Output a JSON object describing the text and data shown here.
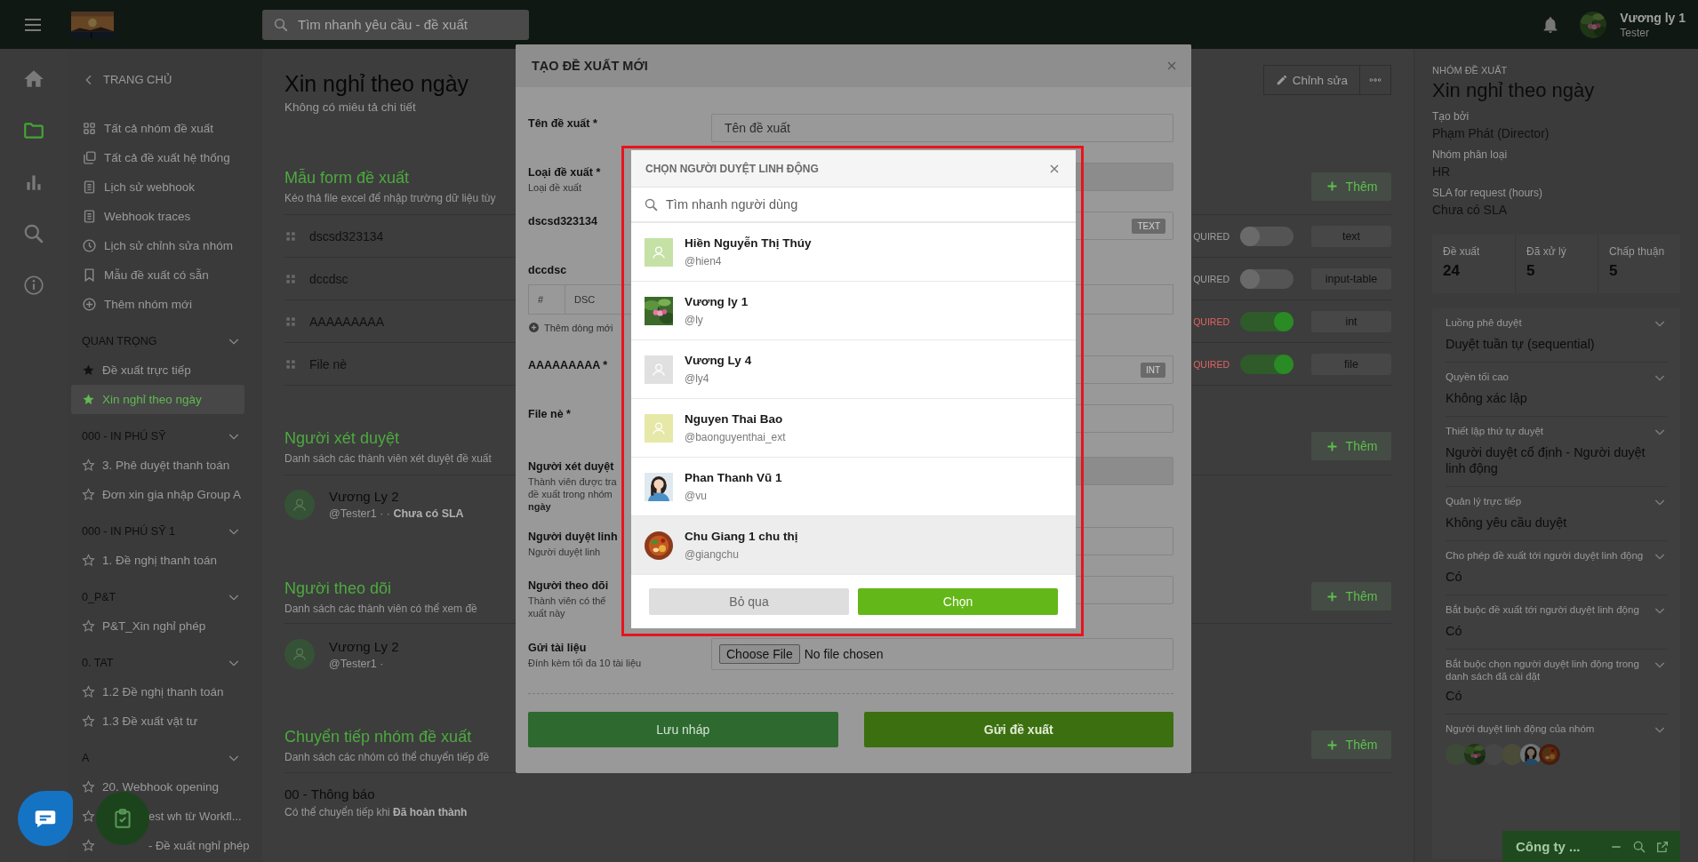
{
  "top_bar": {
    "search": {
      "placeholder": "Tìm nhanh yêu cầu - đề xuất"
    },
    "user": {
      "name": "Vương ly 1",
      "role": "Tester"
    }
  },
  "rail": [
    {
      "kind": "home",
      "selected": false
    },
    {
      "kind": "folder",
      "selected": true
    },
    {
      "kind": "chart",
      "selected": false
    },
    {
      "kind": "search",
      "selected": false
    },
    {
      "kind": "info",
      "selected": false
    }
  ],
  "sidebar": {
    "back_label": "TRANG CHỦ",
    "links": [
      {
        "kind": "grid",
        "label": "Tất cả nhóm đề xuất"
      },
      {
        "kind": "copy",
        "label": "Tất cả đề xuất hệ thống"
      },
      {
        "kind": "document",
        "label": "Lịch sử webhook"
      },
      {
        "kind": "document",
        "label": "Webhook traces"
      },
      {
        "kind": "clock",
        "label": "Lịch sử chỉnh sửa nhóm"
      },
      {
        "kind": "bookmark",
        "label": "Mẫu đề xuất có sẵn"
      },
      {
        "kind": "plus-circle",
        "label": "Thêm nhóm mới"
      }
    ],
    "groups": [
      {
        "title": "QUAN TRỌNG",
        "expanded": true,
        "items": [
          {
            "kind": "item",
            "label": "Đề xuất trực tiếp",
            "starred": true,
            "selected": false
          },
          {
            "kind": "item",
            "label": "Xin nghỉ theo ngày",
            "starred": true,
            "selected": true
          }
        ]
      },
      {
        "title": "000 - IN PHÚ SỸ",
        "expanded": true,
        "items": [
          {
            "kind": "item",
            "label": "3. Phê duyệt thanh toán",
            "starred": false,
            "selected": false
          },
          {
            "kind": "item",
            "label": "Đơn xin gia nhập Group A",
            "starred": false,
            "selected": false
          }
        ]
      },
      {
        "title": "000 - IN PHÚ SỸ 1",
        "expanded": true,
        "items": [
          {
            "kind": "item",
            "label": "1. Đề nghị thanh toán",
            "starred": false,
            "selected": false
          }
        ]
      },
      {
        "title": "0_P&T",
        "expanded": true,
        "items": [
          {
            "kind": "item",
            "label": "P&T_Xin nghỉ phép",
            "starred": false,
            "selected": false
          }
        ]
      },
      {
        "title": "0. TAT",
        "expanded": true,
        "items": [
          {
            "kind": "item",
            "label": "1.2 Đề nghị thanh toán",
            "starred": false,
            "selected": false
          },
          {
            "kind": "item",
            "label": "1.3 Đề xuất vật tư",
            "starred": false,
            "selected": false
          }
        ]
      },
      {
        "title": "A",
        "expanded": true,
        "items": [
          {
            "kind": "item",
            "label": "20. Webhook opening",
            "starred": false,
            "selected": false
          },
          {
            "kind": "covered",
            "label": "est wh từ Workfl...",
            "starred": false,
            "selected": false
          },
          {
            "kind": "covered",
            "label": "- Đề xuất nghỉ phép",
            "starred": false,
            "selected": false
          }
        ]
      }
    ]
  },
  "main": {
    "title": "Xin nghỉ theo ngày",
    "subtitle": "Không có miêu tả chi tiết",
    "edit_button": "Chỉnh sửa",
    "form_section": {
      "title": "Mẫu form đề xuất",
      "description": "Kéo thả file excel để nhập trường dữ liệu tùy",
      "add_button": "Thêm",
      "fields": [
        {
          "name": "dscsd323134",
          "required_label": "QUIRED",
          "required": false,
          "type": "text"
        },
        {
          "name": "dccdsc",
          "required_label": "QUIRED",
          "required": false,
          "type": "input-table"
        },
        {
          "name": "AAAAAAAAA",
          "required_label": "QUIRED",
          "required": true,
          "type": "int"
        },
        {
          "name": "File nè",
          "required_label": "QUIRED",
          "required": true,
          "type": "file"
        }
      ]
    },
    "reviewers": {
      "title": "Người xét duyệt",
      "description": "Danh sách các thành viên xét duyệt đề xuất",
      "add_button": "Thêm",
      "members": [
        {
          "name": "Vương Ly 2",
          "meta": "@Tester1 · · **Chưa có SLA**"
        }
      ]
    },
    "followers": {
      "title": "Người theo dõi",
      "description": "Danh sách các thành viên có thể xem đề",
      "add_button": "Thêm",
      "members": [
        {
          "name": "Vương Ly 2",
          "meta": "@Tester1 ·"
        }
      ]
    },
    "forwarding": {
      "title": "Chuyển tiếp nhóm đề xuất",
      "description": "Danh sách các nhóm có thể chuyển tiếp đề",
      "add_button": "Thêm",
      "groups": [
        {
          "name": "00 - Thông báo",
          "condition": "Có thể chuyển tiếp khi **Đã hoàn thành**"
        }
      ]
    }
  },
  "details": {
    "label": "NHÓM ĐỀ XUẤT",
    "title": "Xin nghỉ theo ngày",
    "facts": [
      {
        "label": "Tạo bởi",
        "value": "Phạm Phát (Director)"
      },
      {
        "label": "Nhóm phân loại",
        "value": "HR"
      },
      {
        "label": "SLA for request (hours)",
        "value": "Chưa có SLA"
      }
    ],
    "stats": [
      {
        "label": "Đề xuất",
        "value": "24"
      },
      {
        "label": "Đã xử lý",
        "value": "5"
      },
      {
        "label": "Chấp thuận",
        "value": "5"
      }
    ],
    "settings": [
      {
        "kind": "text",
        "label": "Luồng phê duyệt",
        "value": "Duyệt tuần tự (sequential)"
      },
      {
        "kind": "text",
        "label": "Quyền tối cao",
        "value": "Không xác lập"
      },
      {
        "kind": "text",
        "label": "Thiết lập thứ tự duyệt",
        "value": "Người duyệt cố định - Người duyệt linh động"
      },
      {
        "kind": "text",
        "label": "Quản lý trực tiếp",
        "value": "Không yêu cầu duyệt"
      },
      {
        "kind": "text",
        "label": "Cho phép đề xuất tới người duyệt linh động",
        "value": "Có"
      },
      {
        "kind": "text",
        "label": "Bắt buộc đề xuất tới người duyệt linh động",
        "value": "Có"
      },
      {
        "kind": "text",
        "label": "Bắt buộc chọn người duyệt linh động trong danh sách đã cài đặt",
        "value": "Có"
      },
      {
        "kind": "avatars",
        "label": "Người duyệt linh động của nhóm",
        "avatars": [
          {
            "kind": "placeholder",
            "color": "#3e4a38"
          },
          {
            "kind": "picture"
          },
          {
            "kind": "placeholder",
            "color": "#464646"
          },
          {
            "kind": "placeholder",
            "color": "#4a4b38"
          },
          {
            "kind": "picture"
          },
          {
            "kind": "picture"
          }
        ]
      }
    ]
  },
  "chat_widget": {
    "title": "Công ty ..."
  },
  "create_dialog": {
    "title": "TẠO ĐỀ XUẤT MỚI",
    "fields": [
      {
        "kind": "text",
        "label": "Tên đề xuất *",
        "placeholder": "Tên đề xuất"
      },
      {
        "kind": "select",
        "label": "Loại đề xuất *",
        "hint": "Loại đề xuất"
      },
      {
        "kind": "text",
        "label": "dscsd323134",
        "badge": "TEXT"
      },
      {
        "kind": "table",
        "label": "dccdsc",
        "columns": [
          "#",
          "DSC"
        ],
        "add_row": "Thêm dòng mới"
      },
      {
        "kind": "text",
        "label": "AAAAAAAAA *",
        "badge": "INT"
      },
      {
        "kind": "text",
        "label": "File nè *"
      },
      {
        "kind": "select",
        "label": "Người xét duyệt",
        "hint": "Thành viên được tra\nđề xuất trong nhóm\n**ngày**"
      },
      {
        "kind": "text",
        "label": "Người duyệt linh",
        "hint": "Người duyệt linh"
      },
      {
        "kind": "text",
        "label": "Người theo dõi",
        "hint": "Thành viên có thể\nxuất này"
      },
      {
        "kind": "file",
        "label": "Gửi tài liệu",
        "hint": "Đính kèm tối đa 10 tài liệu",
        "button": "Choose File",
        "status": "No file chosen"
      }
    ],
    "buttons": [
      {
        "label": "Lưu nháp",
        "kind": "secondary"
      },
      {
        "label": "Gửi đề xuất",
        "kind": "primary"
      }
    ]
  },
  "picker": {
    "title": "CHỌN NGƯỜI DUYỆT LINH ĐỘNG",
    "search": {
      "placeholder": "Tìm nhanh người dùng"
    },
    "users": [
      {
        "name": "Hiền Nguyễn Thị Thúy",
        "handle": "@hien4",
        "kind": "placeholder",
        "color": "#c5e1a5",
        "highlighted": false
      },
      {
        "name": "Vương ly 1",
        "handle": "@ly",
        "kind": "picture",
        "highlighted": false
      },
      {
        "name": "Vương Ly 4",
        "handle": "@ly4",
        "kind": "placeholder",
        "color": "#e0e0e0",
        "highlighted": false
      },
      {
        "name": "Nguyen Thai Bao",
        "handle": "@baonguyenthai_ext",
        "kind": "placeholder",
        "color": "#e6e8a8",
        "highlighted": false
      },
      {
        "name": "Phan Thanh Vũ 1",
        "handle": "@vu",
        "kind": "picture",
        "highlighted": false
      },
      {
        "name": "Chu Giang 1 chu thị",
        "handle": "@giangchu",
        "kind": "picture",
        "highlighted": true
      }
    ],
    "buttons": [
      {
        "label": "Bỏ qua",
        "kind": "secondary"
      },
      {
        "label": "Chọn",
        "kind": "primary"
      }
    ]
  }
}
